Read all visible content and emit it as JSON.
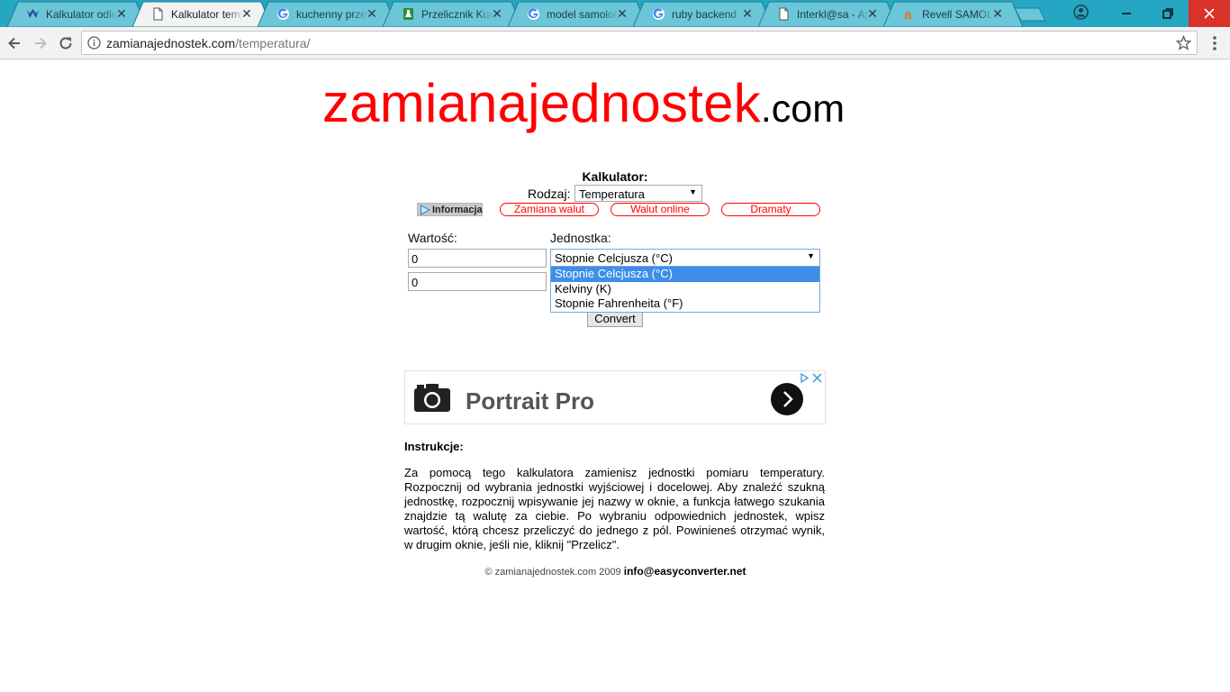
{
  "browser": {
    "tabs": [
      {
        "title": "Kalkulator odległości",
        "icon": "calculator-logo-icon",
        "active": false
      },
      {
        "title": "Kalkulator temperatury",
        "icon": "page-icon",
        "active": true
      },
      {
        "title": "kuchenny przelicznik",
        "icon": "google-icon",
        "active": false
      },
      {
        "title": "Przelicznik Kuchenny",
        "icon": "flask-icon",
        "active": false
      },
      {
        "title": "model samolotu",
        "icon": "google-icon",
        "active": false
      },
      {
        "title": "ruby backend",
        "icon": "google-icon",
        "active": false
      },
      {
        "title": "Interkl@sa - Aplikacje",
        "icon": "page-icon",
        "active": false
      },
      {
        "title": "Revell SAMOLOTY",
        "icon": "amazon-icon",
        "active": false
      }
    ],
    "close_glyph": "✕",
    "url_host": "zamianajednostek.com",
    "url_path": "/temperatura/"
  },
  "page": {
    "logo_main": "zamianajednostek",
    "logo_tld": ".com",
    "calculator_title": "Kalkulator:",
    "type_label": "Rodzaj:",
    "type_value": "Temperatura",
    "info_label": "Informacja",
    "links": [
      "Zamiana walut",
      "Walut online",
      "Dramaty"
    ],
    "value_label": "Wartość:",
    "unit_label": "Jednostka:",
    "value_input_1": "0",
    "value_input_2": "0",
    "unit_selected": "Stopnie Celcjusza (°C)",
    "unit_options": [
      "Stopnie Celcjusza (°C)",
      "Kelviny (K)",
      "Stopnie Fahrenheita (°F)"
    ],
    "convert_label": "Convert",
    "ad_title": "Portrait Pro",
    "instructions_title": "Instrukcje:",
    "instructions_text": "Za pomocą tego kalkulatora zamienisz jednostki pomiaru temperatury. Rozpocznij od wybrania jednostki wyjściowej i docelowej. Aby znaleźć szukną jednostkę, rozpocznij wpisywanie jej nazwy w oknie, a funkcja łatwego szukania znajdzie tą walutę za ciebie. Po wybraniu odpowiednich jednostek, wpisz wartość, którą chcesz przeliczyć do jednego z pól. Powinieneś otrzymać wynik, w drugim oknie, jeśli nie, kliknij \"Przelicz\".",
    "footer_copy": "© zamianajednostek.com 2009",
    "footer_email": "info@easyconverter.net"
  },
  "colors": {
    "tabstrip": "#25a6c2",
    "logo_red": "#ff0000",
    "selection_blue": "#3d8ee8",
    "window_close": "#d9322a"
  }
}
